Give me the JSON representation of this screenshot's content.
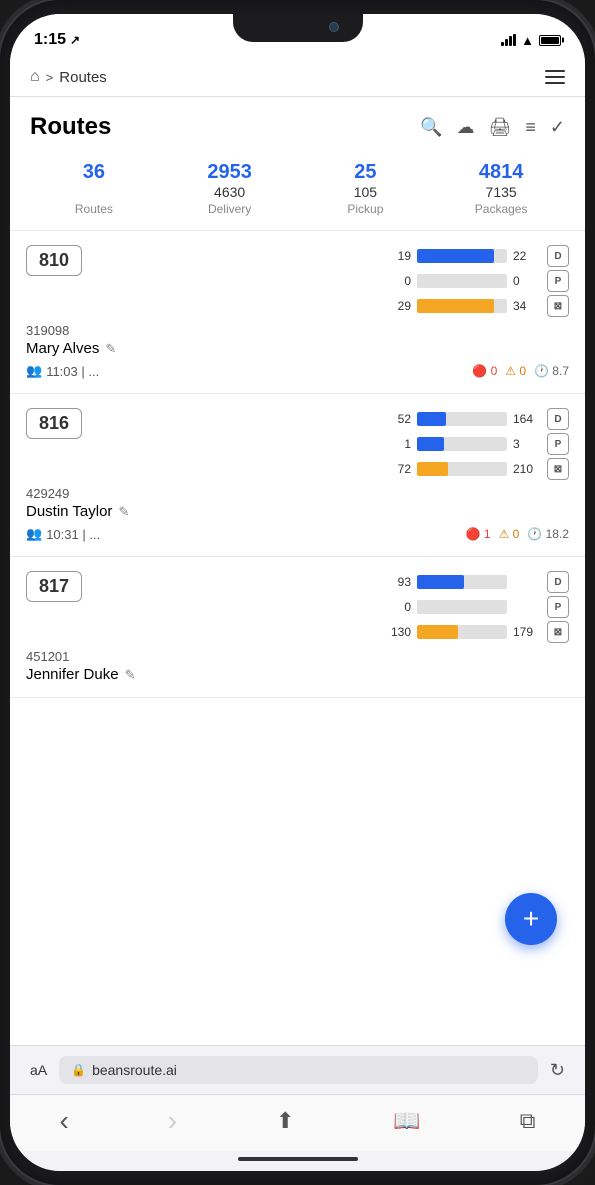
{
  "status_bar": {
    "time": "1:15",
    "location_arrow": "➤"
  },
  "nav": {
    "home_icon": "⌂",
    "breadcrumb_separator": ">",
    "breadcrumb_label": "Routes",
    "menu_icon": "☰"
  },
  "page": {
    "title": "Routes",
    "icons": [
      "search",
      "cloud-upload",
      "print",
      "filter",
      "check-circle"
    ]
  },
  "stats": {
    "routes": {
      "value": "36",
      "sub": "",
      "label": "Routes"
    },
    "delivery": {
      "value": "2953",
      "sub": "4630",
      "label": "Delivery"
    },
    "pickup": {
      "value": "25",
      "sub": "105",
      "label": "Pickup"
    },
    "packages": {
      "value": "4814",
      "sub": "7135",
      "label": "Packages"
    }
  },
  "routes": [
    {
      "id": "810",
      "code": "319098",
      "name": "Mary Alves",
      "time": "11:03",
      "time_suffix": "| ...",
      "badges": {
        "red": "0",
        "yellow": "0",
        "clock": "8.7"
      },
      "bars": [
        {
          "left": "19",
          "fill_pct": 86,
          "type": "blue",
          "right": "22",
          "icon": "D"
        },
        {
          "left": "0",
          "fill_pct": 0,
          "type": "gray",
          "right": "0",
          "icon": "P"
        },
        {
          "left": "29",
          "fill_pct": 85,
          "type": "yellow",
          "right": "34",
          "icon": "box"
        }
      ]
    },
    {
      "id": "816",
      "code": "429249",
      "name": "Dustin Taylor",
      "time": "10:31",
      "time_suffix": "| ...",
      "badges": {
        "red": "1",
        "yellow": "0",
        "clock": "18.2"
      },
      "bars": [
        {
          "left": "52",
          "fill_pct": 32,
          "type": "blue",
          "right": "164",
          "icon": "D"
        },
        {
          "left": "1",
          "fill_pct": 30,
          "type": "blue",
          "right": "3",
          "icon": "P"
        },
        {
          "left": "72",
          "fill_pct": 34,
          "type": "yellow",
          "right": "210",
          "icon": "box"
        }
      ]
    },
    {
      "id": "817",
      "code": "451201",
      "name": "Jennifer Duke",
      "time": "",
      "time_suffix": "",
      "badges": {
        "red": "",
        "yellow": "",
        "clock": ""
      },
      "bars": [
        {
          "left": "93",
          "fill_pct": 52,
          "type": "blue",
          "right": "",
          "icon": "D"
        },
        {
          "left": "0",
          "fill_pct": 0,
          "type": "gray",
          "right": "",
          "icon": "P"
        },
        {
          "left": "130",
          "fill_pct": 45,
          "type": "yellow",
          "right": "179",
          "icon": "box"
        }
      ]
    }
  ],
  "fab": {
    "label": "+"
  },
  "browser": {
    "font_toggle": "aA",
    "lock_icon": "🔒",
    "url": "beansroute.ai",
    "reload_icon": "↻"
  },
  "bottom_nav": {
    "back": "‹",
    "forward": "›",
    "share": "⬆",
    "bookmarks": "📖",
    "tabs": "⧉"
  }
}
